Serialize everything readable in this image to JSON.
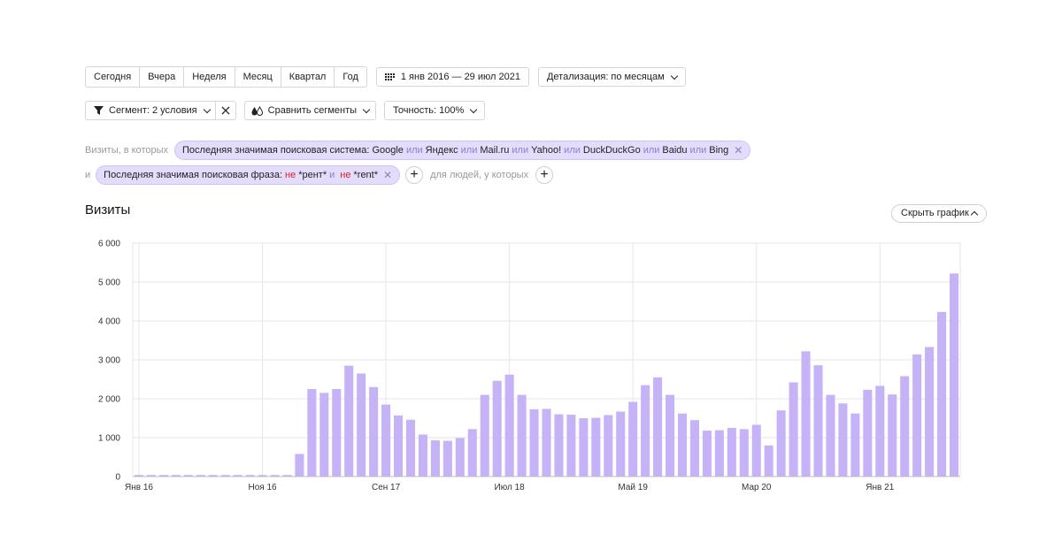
{
  "periods": [
    "Сегодня",
    "Вчера",
    "Неделя",
    "Месяц",
    "Квартал",
    "Год"
  ],
  "date_range": "1 янв 2016 — 29 июл 2021",
  "detail_label": "Детализация: по месяцам",
  "segment_label": "Сегмент: 2 условия",
  "compare_label": "Сравнить сегменты",
  "accuracy_label": "Точность: 100%",
  "filter1": {
    "prefix": "Визиты, в которых",
    "text": "Последняя значимая поисковая система:",
    "engines": [
      "Google",
      "Яндекс",
      "Mail.ru",
      "Yahoo!",
      "DuckDuckGo",
      "Baidu",
      "Bing"
    ],
    "or_word": "или"
  },
  "filter2": {
    "prefix": "и",
    "text": "Последняя значимая поисковая фраза:",
    "not_word": "не",
    "and_word": "и",
    "phrases": [
      "*рент*",
      "*rent*"
    ],
    "people_label": "для людей, у которых"
  },
  "title": "Визиты",
  "hide_chart_label": "Скрыть график",
  "colors": {
    "bar": "#c6b2f7",
    "grid": "#e6e6e6"
  },
  "chart_data": {
    "type": "bar",
    "ylim": [
      0,
      6000
    ],
    "yticks": [
      0,
      1000,
      2000,
      3000,
      4000,
      5000,
      6000
    ],
    "ytick_labels": [
      "0",
      "1 000",
      "2 000",
      "3 000",
      "4 000",
      "5 000",
      "6 000"
    ],
    "xtick_labels": [
      {
        "label": "Янв 16",
        "index": 0
      },
      {
        "label": "Ноя 16",
        "index": 10
      },
      {
        "label": "Сен 17",
        "index": 20
      },
      {
        "label": "Июл 18",
        "index": 30
      },
      {
        "label": "Май 19",
        "index": 40
      },
      {
        "label": "Мар 20",
        "index": 50
      },
      {
        "label": "Янв 21",
        "index": 60
      }
    ],
    "values": [
      40,
      40,
      40,
      40,
      40,
      40,
      40,
      40,
      40,
      40,
      40,
      40,
      40,
      580,
      2250,
      2150,
      2250,
      2850,
      2650,
      2300,
      1850,
      1570,
      1460,
      1080,
      930,
      920,
      990,
      1220,
      2100,
      2460,
      2620,
      2100,
      1730,
      1740,
      1600,
      1590,
      1500,
      1510,
      1580,
      1670,
      1920,
      2350,
      2550,
      2100,
      1620,
      1450,
      1180,
      1190,
      1250,
      1220,
      1330,
      800,
      1700,
      2420,
      3220,
      2860,
      2100,
      1880,
      1620,
      2230,
      2330,
      2110,
      2580,
      3140,
      3330,
      4230,
      5220
    ]
  }
}
